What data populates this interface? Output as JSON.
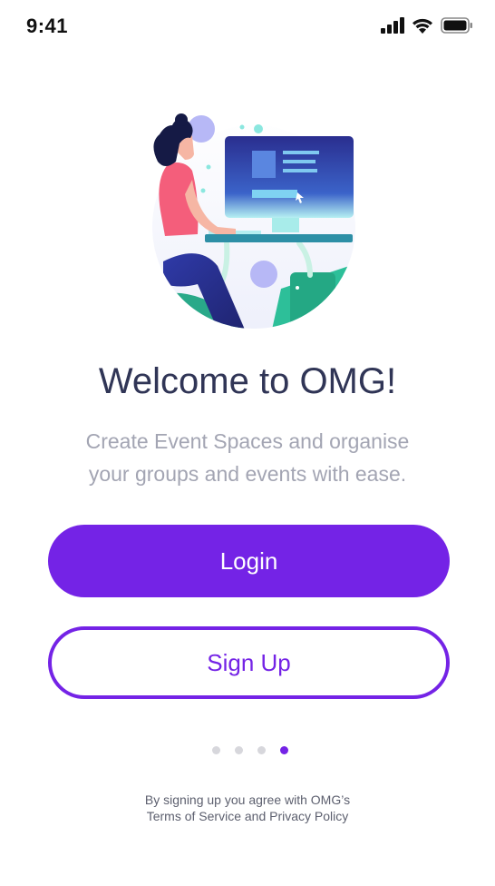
{
  "status_bar": {
    "time": "9:41"
  },
  "icons": {
    "signal": "cellular-signal-icon",
    "wifi": "wifi-icon",
    "battery": "battery-icon"
  },
  "welcome": {
    "title": "Welcome to OMG!",
    "subtitle_line1": "Create Event Spaces and organise",
    "subtitle_line2": "your groups and events with ease."
  },
  "actions": {
    "login_label": "Login",
    "signup_label": "Sign Up"
  },
  "pagination": {
    "total": 4,
    "active_index": 3
  },
  "legal": {
    "line1": "By signing up you agree with OMG’s",
    "line2": "Terms of Service and Privacy Policy"
  },
  "colors": {
    "accent": "#7423e6",
    "title": "#303556",
    "subtitle": "#a3a5b3"
  }
}
